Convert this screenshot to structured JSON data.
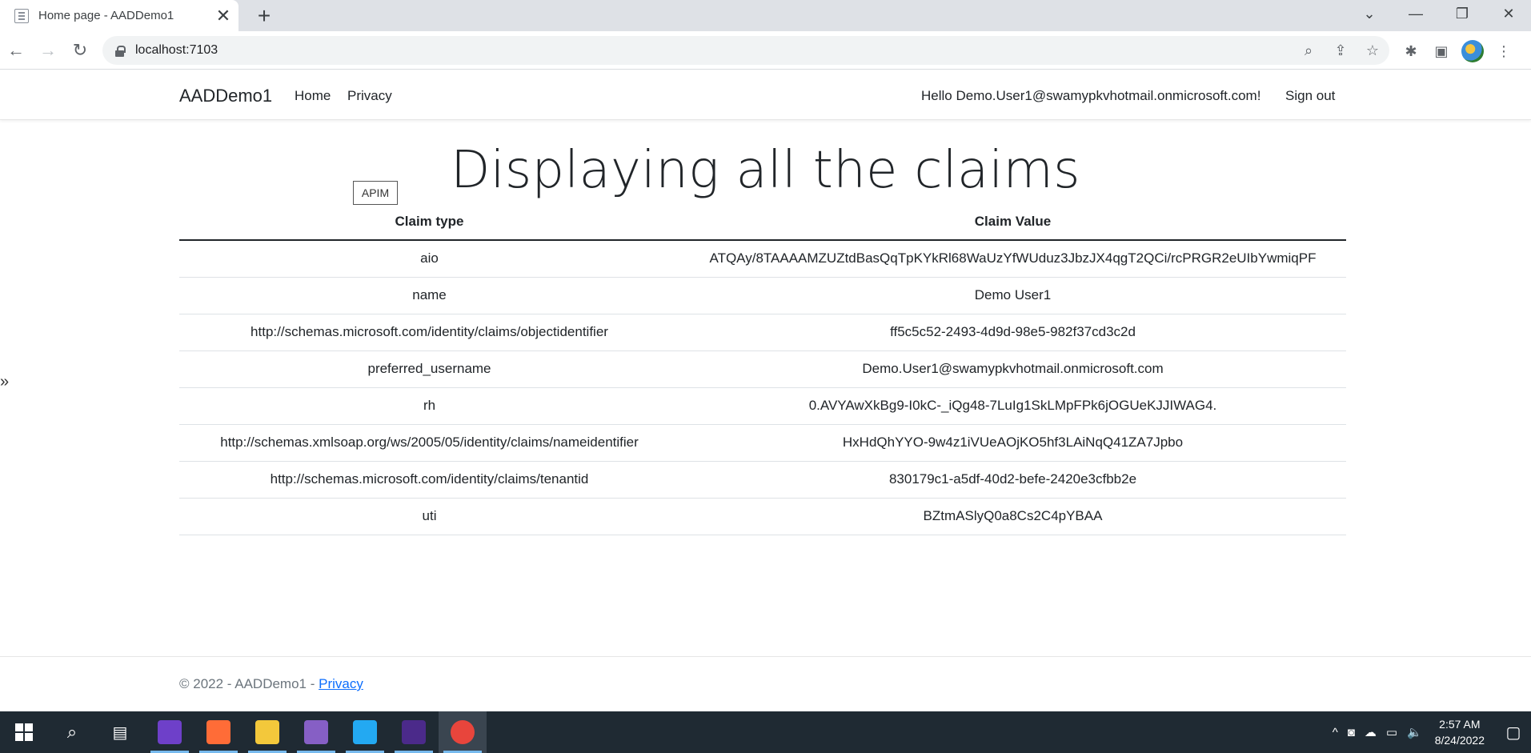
{
  "browser": {
    "tab_title": "Home page - AADDemo1",
    "url": "localhost:7103",
    "icons": {
      "new_tab": "+",
      "close": "✕",
      "back": "←",
      "forward": "→",
      "reload": "↻",
      "zoom": "⌕",
      "share": "⇪",
      "star": "☆",
      "extensions": "✱",
      "side_panel": "▣",
      "tab_search": "⌄",
      "minimize": "—",
      "restore": "❐",
      "window_close": "✕"
    }
  },
  "navbar": {
    "brand": "AADDemo1",
    "links": [
      "Home",
      "Privacy"
    ],
    "greeting": "Hello Demo.User1@swamypkvhotmail.onmicrosoft.com!",
    "signout": "Sign out"
  },
  "main": {
    "heading": "Displaying all the claims",
    "apim_button": "APIM",
    "sidebar_toggle": "»",
    "table": {
      "headers": [
        "Claim type",
        "Claim Value"
      ],
      "rows": [
        [
          "aio",
          "ATQAy/8TAAAAMZUZtdBasQqTpKYkRl68WaUzYfWUduz3JbzJX4qgT2QCi/rcPRGR2eUIbYwmiqPF"
        ],
        [
          "name",
          "Demo User1"
        ],
        [
          "http://schemas.microsoft.com/identity/claims/objectidentifier",
          "ff5c5c52-2493-4d9d-98e5-982f37cd3c2d"
        ],
        [
          "preferred_username",
          "Demo.User1@swamypkvhotmail.onmicrosoft.com"
        ],
        [
          "rh",
          "0.AVYAwXkBg9-I0kC-_iQg48-7LuIg1SkLMpFPk6jOGUeKJJIWAG4."
        ],
        [
          "http://schemas.xmlsoap.org/ws/2005/05/identity/claims/nameidentifier",
          "HxHdQhYYO-9w4z1iVUeAOjKO5hf3LAiNqQ41ZA7Jpbo"
        ],
        [
          "http://schemas.microsoft.com/identity/claims/tenantid",
          "830179c1-a5df-40d2-befe-2420e3cfbb2e"
        ],
        [
          "uti",
          "BZtmASlyQ0a8Cs2C4pYBAA"
        ]
      ]
    }
  },
  "footer": {
    "text": "© 2022 - AADDemo1 - ",
    "link": "Privacy"
  },
  "taskbar": {
    "apps": [
      {
        "name": "github-desktop-icon",
        "color": "#6e40c9"
      },
      {
        "name": "postman-icon",
        "color": "#ff6c37"
      },
      {
        "name": "file-explorer-icon",
        "color": "#f3c83b"
      },
      {
        "name": "visual-studio-icon",
        "color": "#865fc5"
      },
      {
        "name": "vscode-icon",
        "color": "#23a9f2"
      },
      {
        "name": "terminal-icon",
        "color": "#4b2a8a"
      },
      {
        "name": "chrome-icon",
        "color": "#e8453c"
      }
    ],
    "tray_icons": {
      "chevron": "^",
      "meet": "◙",
      "onedrive": "☁",
      "network": "▭",
      "volume": "🔈",
      "notifications": "▢"
    },
    "time": "2:57 AM",
    "date": "8/24/2022"
  }
}
